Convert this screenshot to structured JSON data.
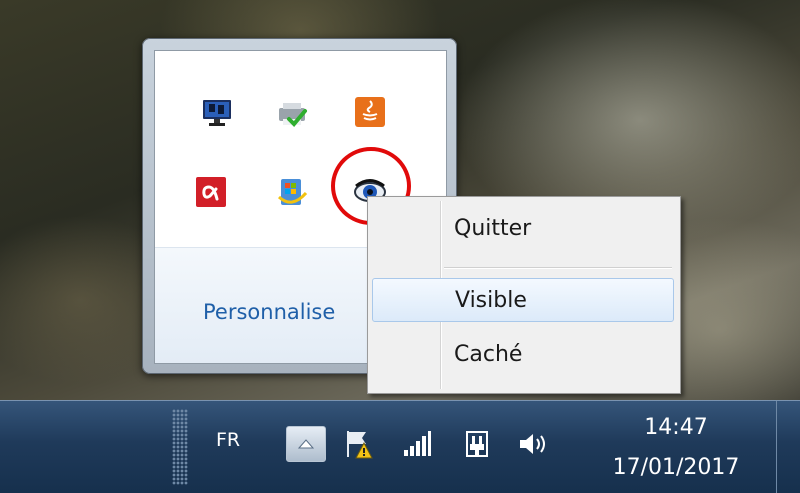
{
  "flyout": {
    "customize_link": "Personnalise",
    "icons": [
      "monitor-icon",
      "printer-check-icon",
      "java-icon",
      "avira-icon",
      "windows-update-icon",
      "eye-app-icon"
    ]
  },
  "context_menu": {
    "items": [
      {
        "label": "Quitter"
      },
      {
        "label": "Visible",
        "state": "hovered"
      },
      {
        "label": "Caché"
      }
    ]
  },
  "taskbar": {
    "language": "FR",
    "tray_icons": [
      "show-hidden-icons-button",
      "action-center-flag-icon",
      "network-signal-icon",
      "power-plug-icon",
      "volume-icon"
    ],
    "clock": {
      "time": "14:47",
      "date": "17/01/2017"
    }
  },
  "colors": {
    "highlight_ring": "#e10a0a",
    "link": "#1f5fa8",
    "menu_hover": "#dceaf9",
    "taskbar": "#1f3a5a"
  }
}
